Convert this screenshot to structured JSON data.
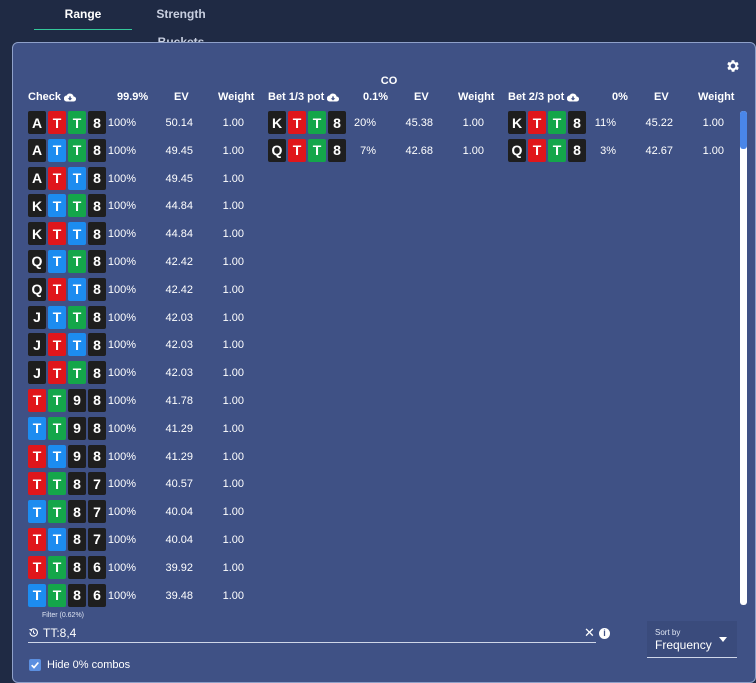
{
  "tabs": [
    {
      "label": "Range",
      "active": true
    },
    {
      "label": "Strength Buckets",
      "active": false
    }
  ],
  "position_label": "CO",
  "columns": [
    {
      "name": "Check",
      "freq": "99.9%",
      "ev_label": "EV",
      "weight_label": "Weight",
      "rows": [
        {
          "cards": [
            {
              "r": "A",
              "c": "black"
            },
            {
              "r": "T",
              "c": "red"
            },
            {
              "r": "T",
              "c": "green"
            },
            {
              "r": "8",
              "c": "black"
            }
          ],
          "freq": "100%",
          "ev": "50.14",
          "weight": "1.00"
        },
        {
          "cards": [
            {
              "r": "A",
              "c": "black"
            },
            {
              "r": "T",
              "c": "blue"
            },
            {
              "r": "T",
              "c": "green"
            },
            {
              "r": "8",
              "c": "black"
            }
          ],
          "freq": "100%",
          "ev": "49.45",
          "weight": "1.00"
        },
        {
          "cards": [
            {
              "r": "A",
              "c": "black"
            },
            {
              "r": "T",
              "c": "red"
            },
            {
              "r": "T",
              "c": "blue"
            },
            {
              "r": "8",
              "c": "black"
            }
          ],
          "freq": "100%",
          "ev": "49.45",
          "weight": "1.00"
        },
        {
          "cards": [
            {
              "r": "K",
              "c": "black"
            },
            {
              "r": "T",
              "c": "blue"
            },
            {
              "r": "T",
              "c": "green"
            },
            {
              "r": "8",
              "c": "black"
            }
          ],
          "freq": "100%",
          "ev": "44.84",
          "weight": "1.00"
        },
        {
          "cards": [
            {
              "r": "K",
              "c": "black"
            },
            {
              "r": "T",
              "c": "red"
            },
            {
              "r": "T",
              "c": "blue"
            },
            {
              "r": "8",
              "c": "black"
            }
          ],
          "freq": "100%",
          "ev": "44.84",
          "weight": "1.00"
        },
        {
          "cards": [
            {
              "r": "Q",
              "c": "black"
            },
            {
              "r": "T",
              "c": "blue"
            },
            {
              "r": "T",
              "c": "green"
            },
            {
              "r": "8",
              "c": "black"
            }
          ],
          "freq": "100%",
          "ev": "42.42",
          "weight": "1.00"
        },
        {
          "cards": [
            {
              "r": "Q",
              "c": "black"
            },
            {
              "r": "T",
              "c": "red"
            },
            {
              "r": "T",
              "c": "blue"
            },
            {
              "r": "8",
              "c": "black"
            }
          ],
          "freq": "100%",
          "ev": "42.42",
          "weight": "1.00"
        },
        {
          "cards": [
            {
              "r": "J",
              "c": "black"
            },
            {
              "r": "T",
              "c": "blue"
            },
            {
              "r": "T",
              "c": "green"
            },
            {
              "r": "8",
              "c": "black"
            }
          ],
          "freq": "100%",
          "ev": "42.03",
          "weight": "1.00"
        },
        {
          "cards": [
            {
              "r": "J",
              "c": "black"
            },
            {
              "r": "T",
              "c": "red"
            },
            {
              "r": "T",
              "c": "blue"
            },
            {
              "r": "8",
              "c": "black"
            }
          ],
          "freq": "100%",
          "ev": "42.03",
          "weight": "1.00"
        },
        {
          "cards": [
            {
              "r": "J",
              "c": "black"
            },
            {
              "r": "T",
              "c": "red"
            },
            {
              "r": "T",
              "c": "green"
            },
            {
              "r": "8",
              "c": "black"
            }
          ],
          "freq": "100%",
          "ev": "42.03",
          "weight": "1.00"
        },
        {
          "cards": [
            {
              "r": "T",
              "c": "red"
            },
            {
              "r": "T",
              "c": "green"
            },
            {
              "r": "9",
              "c": "black"
            },
            {
              "r": "8",
              "c": "black"
            }
          ],
          "freq": "100%",
          "ev": "41.78",
          "weight": "1.00"
        },
        {
          "cards": [
            {
              "r": "T",
              "c": "blue"
            },
            {
              "r": "T",
              "c": "green"
            },
            {
              "r": "9",
              "c": "black"
            },
            {
              "r": "8",
              "c": "black"
            }
          ],
          "freq": "100%",
          "ev": "41.29",
          "weight": "1.00"
        },
        {
          "cards": [
            {
              "r": "T",
              "c": "red"
            },
            {
              "r": "T",
              "c": "blue"
            },
            {
              "r": "9",
              "c": "black"
            },
            {
              "r": "8",
              "c": "black"
            }
          ],
          "freq": "100%",
          "ev": "41.29",
          "weight": "1.00"
        },
        {
          "cards": [
            {
              "r": "T",
              "c": "red"
            },
            {
              "r": "T",
              "c": "green"
            },
            {
              "r": "8",
              "c": "black"
            },
            {
              "r": "7",
              "c": "black"
            }
          ],
          "freq": "100%",
          "ev": "40.57",
          "weight": "1.00"
        },
        {
          "cards": [
            {
              "r": "T",
              "c": "blue"
            },
            {
              "r": "T",
              "c": "green"
            },
            {
              "r": "8",
              "c": "black"
            },
            {
              "r": "7",
              "c": "black"
            }
          ],
          "freq": "100%",
          "ev": "40.04",
          "weight": "1.00"
        },
        {
          "cards": [
            {
              "r": "T",
              "c": "red"
            },
            {
              "r": "T",
              "c": "blue"
            },
            {
              "r": "8",
              "c": "black"
            },
            {
              "r": "7",
              "c": "black"
            }
          ],
          "freq": "100%",
          "ev": "40.04",
          "weight": "1.00"
        },
        {
          "cards": [
            {
              "r": "T",
              "c": "red"
            },
            {
              "r": "T",
              "c": "green"
            },
            {
              "r": "8",
              "c": "black"
            },
            {
              "r": "6",
              "c": "black"
            }
          ],
          "freq": "100%",
          "ev": "39.92",
          "weight": "1.00"
        },
        {
          "cards": [
            {
              "r": "T",
              "c": "blue"
            },
            {
              "r": "T",
              "c": "green"
            },
            {
              "r": "8",
              "c": "black"
            },
            {
              "r": "6",
              "c": "black"
            }
          ],
          "freq": "100%",
          "ev": "39.48",
          "weight": "1.00"
        }
      ]
    },
    {
      "name": "Bet 1/3 pot",
      "freq": "0.1%",
      "ev_label": "EV",
      "weight_label": "Weight",
      "rows": [
        {
          "cards": [
            {
              "r": "K",
              "c": "black"
            },
            {
              "r": "T",
              "c": "red"
            },
            {
              "r": "T",
              "c": "green"
            },
            {
              "r": "8",
              "c": "black"
            }
          ],
          "freq": "20%",
          "ev": "45.38",
          "weight": "1.00"
        },
        {
          "cards": [
            {
              "r": "Q",
              "c": "black"
            },
            {
              "r": "T",
              "c": "red"
            },
            {
              "r": "T",
              "c": "green"
            },
            {
              "r": "8",
              "c": "black"
            }
          ],
          "freq": "7%",
          "ev": "42.68",
          "weight": "1.00"
        }
      ]
    },
    {
      "name": "Bet 2/3 pot",
      "freq": "0%",
      "ev_label": "EV",
      "weight_label": "Weight",
      "rows": [
        {
          "cards": [
            {
              "r": "K",
              "c": "black"
            },
            {
              "r": "T",
              "c": "red"
            },
            {
              "r": "T",
              "c": "green"
            },
            {
              "r": "8",
              "c": "black"
            }
          ],
          "freq": "11%",
          "ev": "45.22",
          "weight": "1.00"
        },
        {
          "cards": [
            {
              "r": "Q",
              "c": "black"
            },
            {
              "r": "T",
              "c": "red"
            },
            {
              "r": "T",
              "c": "green"
            },
            {
              "r": "8",
              "c": "black"
            }
          ],
          "freq": "3%",
          "ev": "42.67",
          "weight": "1.00"
        }
      ]
    }
  ],
  "card_colors": {
    "black": "#1e1e1e",
    "red": "#e0161b",
    "blue": "#1c8cf0",
    "green": "#14a64a"
  },
  "filter": {
    "label": "Filter (0.62%)",
    "value": "TT:8,4"
  },
  "sort": {
    "label": "Sort by",
    "value": "Frequency"
  },
  "hide_zero": {
    "label": "Hide 0% combos",
    "checked": true
  },
  "icons": {
    "settings": "gear-icon",
    "download": "cloud-download-icon",
    "history": "history-icon",
    "clear": "close-icon",
    "info": "info-icon"
  }
}
